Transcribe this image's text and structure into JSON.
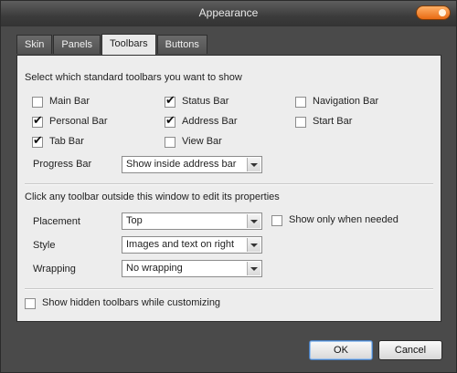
{
  "window": {
    "title": "Appearance"
  },
  "tabs": [
    {
      "label": "Skin"
    },
    {
      "label": "Panels"
    },
    {
      "label": "Toolbars"
    },
    {
      "label": "Buttons"
    }
  ],
  "toolbars_section": {
    "heading": "Select which standard toolbars you want to show",
    "checkboxes": [
      {
        "label": "Main Bar",
        "checked": false
      },
      {
        "label": "Status Bar",
        "checked": true
      },
      {
        "label": "Navigation Bar",
        "checked": false
      },
      {
        "label": "Personal Bar",
        "checked": true
      },
      {
        "label": "Address Bar",
        "checked": true
      },
      {
        "label": "Start Bar",
        "checked": false
      },
      {
        "label": "Tab Bar",
        "checked": true
      },
      {
        "label": "View Bar",
        "checked": false
      }
    ],
    "progress_bar": {
      "label": "Progress Bar",
      "value": "Show inside address bar"
    }
  },
  "properties_section": {
    "heading": "Click any toolbar outside this window to edit its properties",
    "placement": {
      "label": "Placement",
      "value": "Top"
    },
    "style": {
      "label": "Style",
      "value": "Images and text on right"
    },
    "wrapping": {
      "label": "Wrapping",
      "value": "No wrapping"
    },
    "show_only_when_needed": {
      "label": "Show only when needed",
      "checked": false
    }
  },
  "show_hidden": {
    "label": "Show hidden toolbars while customizing",
    "checked": false
  },
  "buttons": {
    "ok": "OK",
    "cancel": "Cancel"
  },
  "colors": {
    "accent": "#e86a12",
    "panel": "#ededed",
    "chrome": "#4a4a4a"
  },
  "check_glyph": "✔"
}
